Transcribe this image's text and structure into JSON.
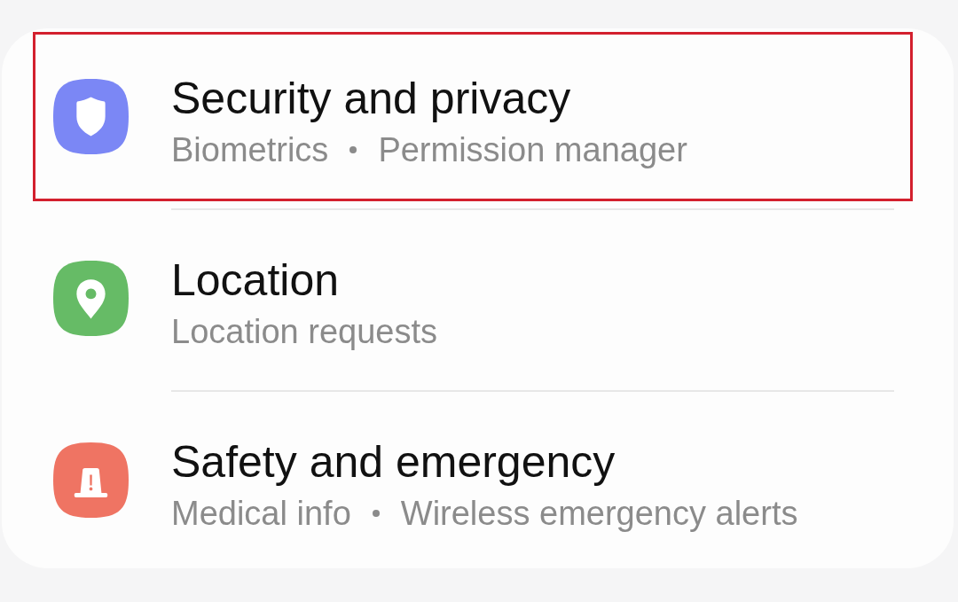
{
  "items": [
    {
      "title": "Security and privacy",
      "subtitle": [
        "Biometrics",
        "Permission manager"
      ],
      "color": "#7b87f5",
      "highlighted": true
    },
    {
      "title": "Location",
      "subtitle": [
        "Location requests"
      ],
      "color": "#66bb66",
      "highlighted": false
    },
    {
      "title": "Safety and emergency",
      "subtitle": [
        "Medical info",
        "Wireless emergency alerts"
      ],
      "color": "#ef7463",
      "highlighted": false
    }
  ]
}
